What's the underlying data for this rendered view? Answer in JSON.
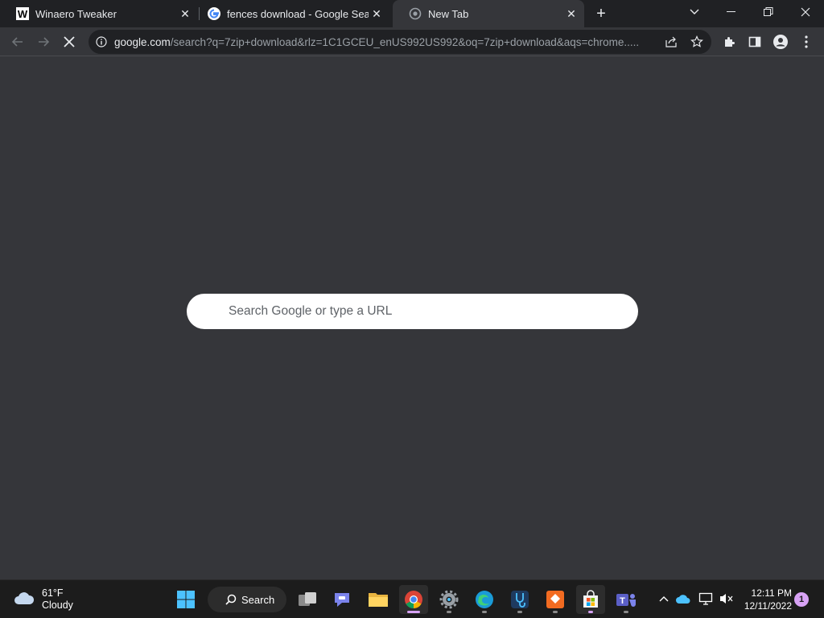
{
  "tabs": [
    {
      "title": "Winaero Tweaker",
      "favicon": "winaero-w-icon"
    },
    {
      "title": "fences download - Google Search",
      "favicon": "google-g-icon"
    },
    {
      "title": "New Tab",
      "favicon": "chrome-newtab-icon",
      "active": true
    }
  ],
  "window_controls": [
    "tab-search-icon",
    "minimize-icon",
    "restore-icon",
    "close-icon"
  ],
  "toolbar": {
    "url_host": "google.com",
    "url_path": "/search?q=7zip+download&rlz=1C1GCEU_enUS992US992&oq=7zip+download&aqs=chrome.....",
    "loading": true
  },
  "newtab": {
    "search_placeholder": "Search Google or type a URL"
  },
  "taskbar": {
    "weather_temp": "61°F",
    "weather_desc": "Cloudy",
    "search_label": "Search",
    "time": "12:11 PM",
    "date": "12/11/2022",
    "notification_count": "1"
  },
  "colors": {
    "tabstrip": "#202124",
    "toolbar": "#35363a",
    "omnibox": "#202124",
    "taskbar": "#1c1c1c",
    "accent": "#d8a3f5"
  }
}
